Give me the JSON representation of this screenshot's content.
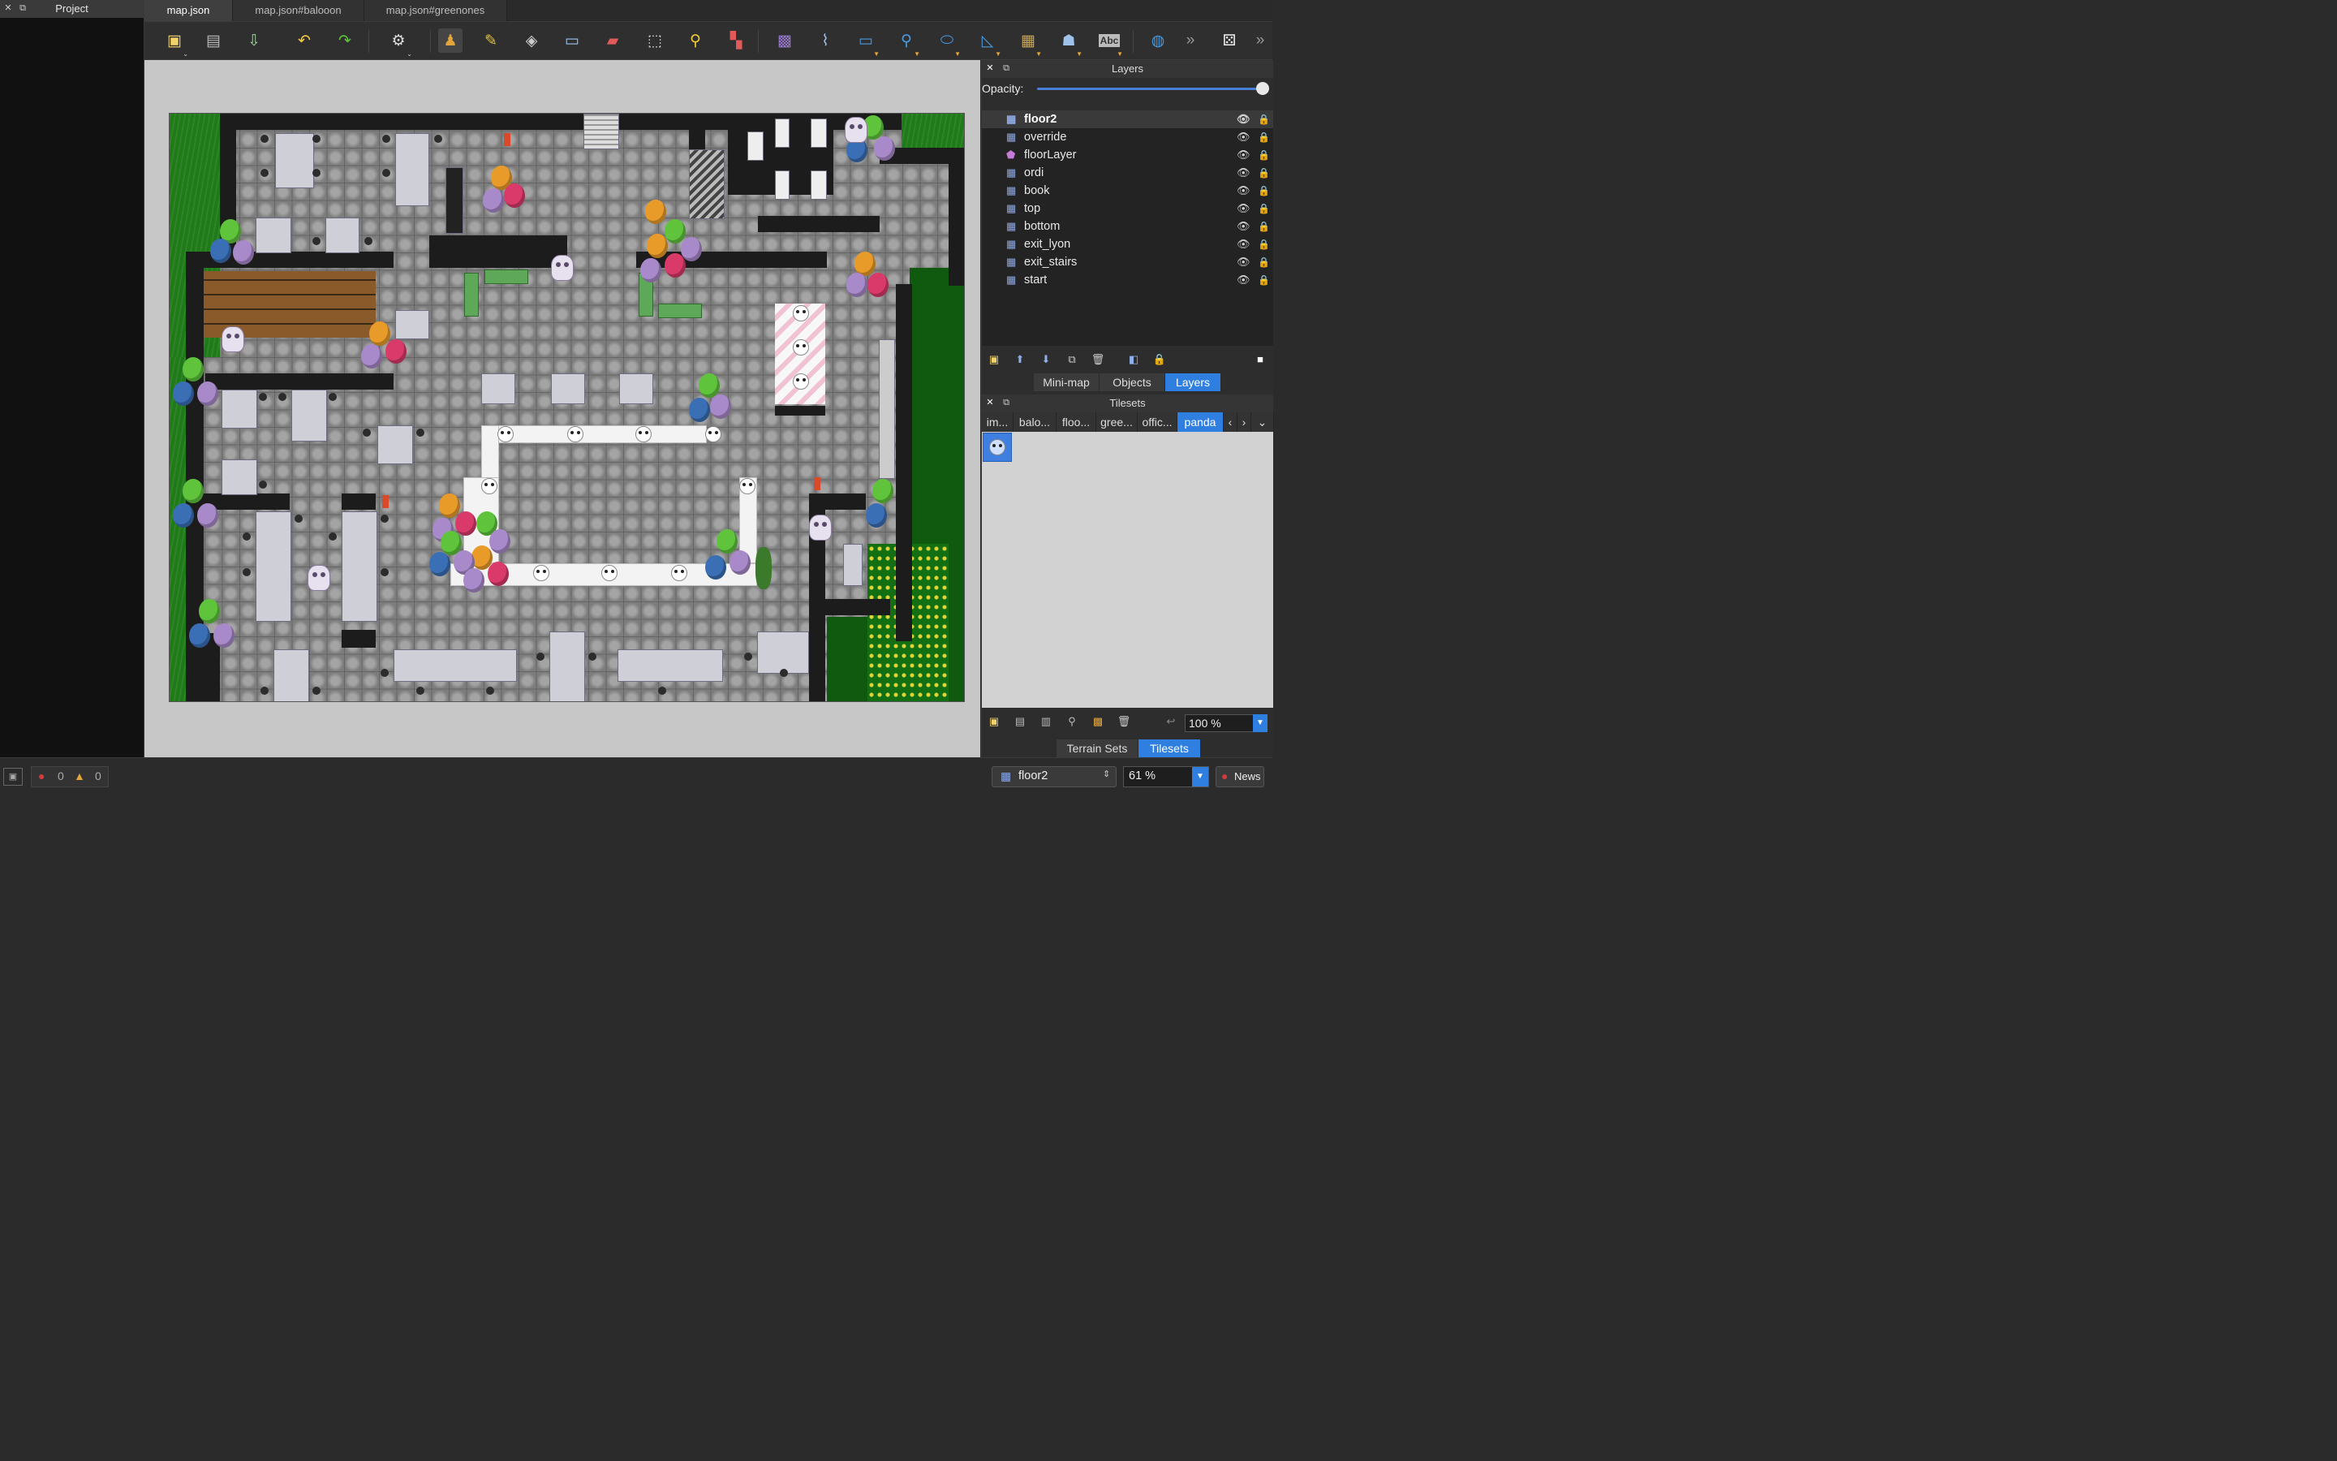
{
  "colors": {
    "accent": "#2f7fe0",
    "panel_bg": "#2d2d2d",
    "canvas_bg": "#c7c7c7",
    "grass": "#1f7a18",
    "error": "#d43b3b",
    "warning": "#e2a43b"
  },
  "project_panel": {
    "title": "Project"
  },
  "tabs": [
    {
      "label": "map.json",
      "active": true
    },
    {
      "label": "map.json#balooon",
      "active": false
    },
    {
      "label": "map.json#greenones",
      "active": false
    }
  ],
  "toolbar": {
    "icons": [
      "new-map-icon",
      "open-icon",
      "save-icon",
      "undo-icon",
      "redo-icon",
      "settings-icon",
      "stamp-brush-icon",
      "terrain-brush-icon",
      "wang-brush-icon",
      "bucket-fill-icon",
      "eraser-icon",
      "rectangle-select-icon",
      "magic-wand-icon",
      "select-same-tile-icon",
      "object-select-icon",
      "edit-polygons-icon",
      "insert-rectangle-icon",
      "insert-point-icon",
      "insert-ellipse-icon",
      "insert-polygon-icon",
      "insert-tile-icon",
      "insert-template-icon",
      "insert-text-icon",
      "world-icon",
      "more-icon",
      "random-mode-icon"
    ],
    "text_tool_label": "Abc"
  },
  "layers_panel": {
    "title": "Layers",
    "opacity_label": "Opacity:",
    "opacity_value": 1.0,
    "layers": [
      {
        "name": "floor2",
        "type": "tile",
        "selected": true
      },
      {
        "name": "override",
        "type": "tile",
        "selected": false
      },
      {
        "name": "floorLayer",
        "type": "object",
        "selected": false
      },
      {
        "name": "ordi",
        "type": "tile",
        "selected": false
      },
      {
        "name": "book",
        "type": "tile",
        "selected": false
      },
      {
        "name": "top",
        "type": "tile",
        "selected": false
      },
      {
        "name": "bottom",
        "type": "tile",
        "selected": false
      },
      {
        "name": "exit_lyon",
        "type": "tile",
        "selected": false
      },
      {
        "name": "exit_stairs",
        "type": "tile",
        "selected": false
      },
      {
        "name": "start",
        "type": "tile",
        "selected": false
      }
    ],
    "bottom_tabs": [
      {
        "label": "Mini-map",
        "active": false
      },
      {
        "label": "Objects",
        "active": false
      },
      {
        "label": "Layers",
        "active": true
      }
    ]
  },
  "tilesets_panel": {
    "title": "Tilesets",
    "tabs": [
      {
        "label": "im...",
        "active": false
      },
      {
        "label": "balo...",
        "active": false
      },
      {
        "label": "floo...",
        "active": false
      },
      {
        "label": "gree...",
        "active": false
      },
      {
        "label": "offic...",
        "active": false
      },
      {
        "label": "panda",
        "active": true
      }
    ],
    "zoom": "100 %",
    "bottom_tabs": [
      {
        "label": "Terrain Sets",
        "active": false
      },
      {
        "label": "Tilesets",
        "active": true
      }
    ]
  },
  "statusbar": {
    "errors": "0",
    "warnings": "0",
    "current_layer": "floor2",
    "zoom": "61 %",
    "news_label": "News"
  }
}
